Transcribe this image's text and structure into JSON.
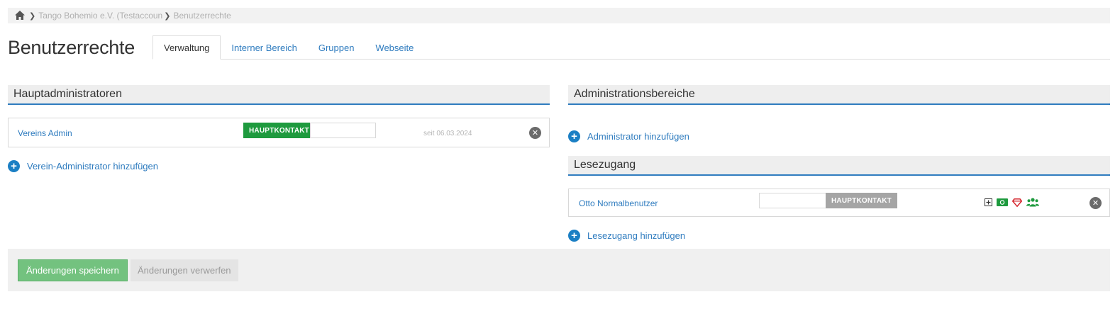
{
  "breadcrumb": {
    "home_icon": "home-icon",
    "items": [
      "Tango Bohemio e.V. (Testaccoun",
      "Benutzerrechte"
    ]
  },
  "page_title": "Benutzerrechte",
  "tabs": [
    {
      "label": "Verwaltung",
      "active": true
    },
    {
      "label": "Interner Bereich",
      "active": false
    },
    {
      "label": "Gruppen",
      "active": false
    },
    {
      "label": "Webseite",
      "active": false
    }
  ],
  "left": {
    "header": "Hauptadministratoren",
    "admin": {
      "name": "Vereins Admin",
      "badge": "HAUPTKONTAKT",
      "since": "seit 06.03.2024",
      "remove_icon": "close-icon"
    },
    "add_label": "Verein-Administrator hinzufügen"
  },
  "right": {
    "admin_header": "Administrationsbereiche",
    "admin_add_label": "Administrator hinzufügen",
    "read_header": "Lesezugang",
    "read_user": {
      "name": "Otto Normalbenutzer",
      "badge": "HAUPTKONTAKT",
      "icons": [
        "plus-square-icon",
        "money-icon",
        "diamond-icon",
        "users-icon"
      ],
      "remove_icon": "close-icon"
    },
    "read_add_label": "Lesezugang hinzufügen"
  },
  "footer": {
    "save_label": "Änderungen speichern",
    "discard_label": "Änderungen verwerfen"
  },
  "colors": {
    "accent": "#2f7cbf",
    "badge_active": "#1e9a3e",
    "badge_inactive": "#a5a5a5",
    "save_button": "#73c27f"
  }
}
